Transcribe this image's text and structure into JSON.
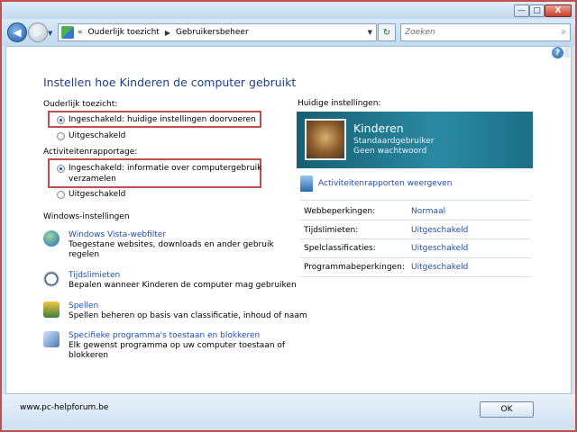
{
  "window": {
    "caption_buttons": {
      "minimize": "—",
      "maximize": "□",
      "close": "X"
    }
  },
  "nav": {
    "back_glyph": "◀",
    "forward_glyph": "▶",
    "history_glyph": "▼",
    "breadcrumb": [
      "Ouderlijk toezicht",
      "Gebruikersbeheer"
    ],
    "breadcrumb_prefix": "«",
    "breadcrumb_sep": "▶",
    "address_dropdown": "▼",
    "refresh_glyph": "↻",
    "search_placeholder": "Zoeken",
    "search_icon": "⌕"
  },
  "help_glyph": "?",
  "page_title": "Instellen hoe Kinderen de computer gebruikt",
  "parental_control": {
    "label": "Ouderlijk toezicht:",
    "options": [
      {
        "text": "Ingeschakeld: huidige instellingen doorvoeren",
        "checked": true
      },
      {
        "text": "Uitgeschakeld",
        "checked": false
      }
    ]
  },
  "activity_reports": {
    "label": "Activiteitenrapportage:",
    "options": [
      {
        "text_line1": "Ingeschakeld: informatie over computergebruik",
        "text_line2": "verzamelen",
        "checked": true
      },
      {
        "text_line1": "Uitgeschakeld",
        "text_line2": "",
        "checked": false
      }
    ]
  },
  "windows_settings": {
    "label": "Windows-instellingen",
    "items": [
      {
        "icon": "globe-icon",
        "link": "Windows Vista-webfilter",
        "desc1": "Toegestane websites, downloads en ander gebruik",
        "desc2": "regelen"
      },
      {
        "icon": "clock-icon",
        "link": "Tijdslimieten",
        "desc1": "Bepalen wanneer Kinderen de computer mag gebruiken",
        "desc2": ""
      },
      {
        "icon": "games-icon",
        "link": "Spellen",
        "desc1": "Spellen beheren op basis van classificatie, inhoud of naam",
        "desc2": ""
      },
      {
        "icon": "programs-icon",
        "link": "Specifieke programma's toestaan en blokkeren",
        "desc1": "Elk gewenst programma op uw computer toestaan of",
        "desc2": "blokkeren"
      }
    ]
  },
  "current_settings": {
    "label": "Huidige instellingen:",
    "user": {
      "name": "Kinderen",
      "type": "Standaardgebruiker",
      "password": "Geen wachtwoord",
      "avatar": "cat-avatar"
    },
    "reports_link": "Activiteitenrapporten weergeven",
    "rows": [
      {
        "label": "Webbeperkingen:",
        "value": "Normaal"
      },
      {
        "label": "Tijdslimieten:",
        "value": "Uitgeschakeld"
      },
      {
        "label": "Spelclassificaties:",
        "value": "Uitgeschakeld"
      },
      {
        "label": "Programmabeperkingen:",
        "value": "Uitgeschakeld"
      }
    ]
  },
  "footer": {
    "site": "www.pc-helpforum.be",
    "ok_label": "OK"
  },
  "colors": {
    "accent_blue": "#1f4fa8",
    "title_blue": "#1d3f8a",
    "highlight_red": "#c0504d",
    "card_teal": "#1c6f86"
  }
}
